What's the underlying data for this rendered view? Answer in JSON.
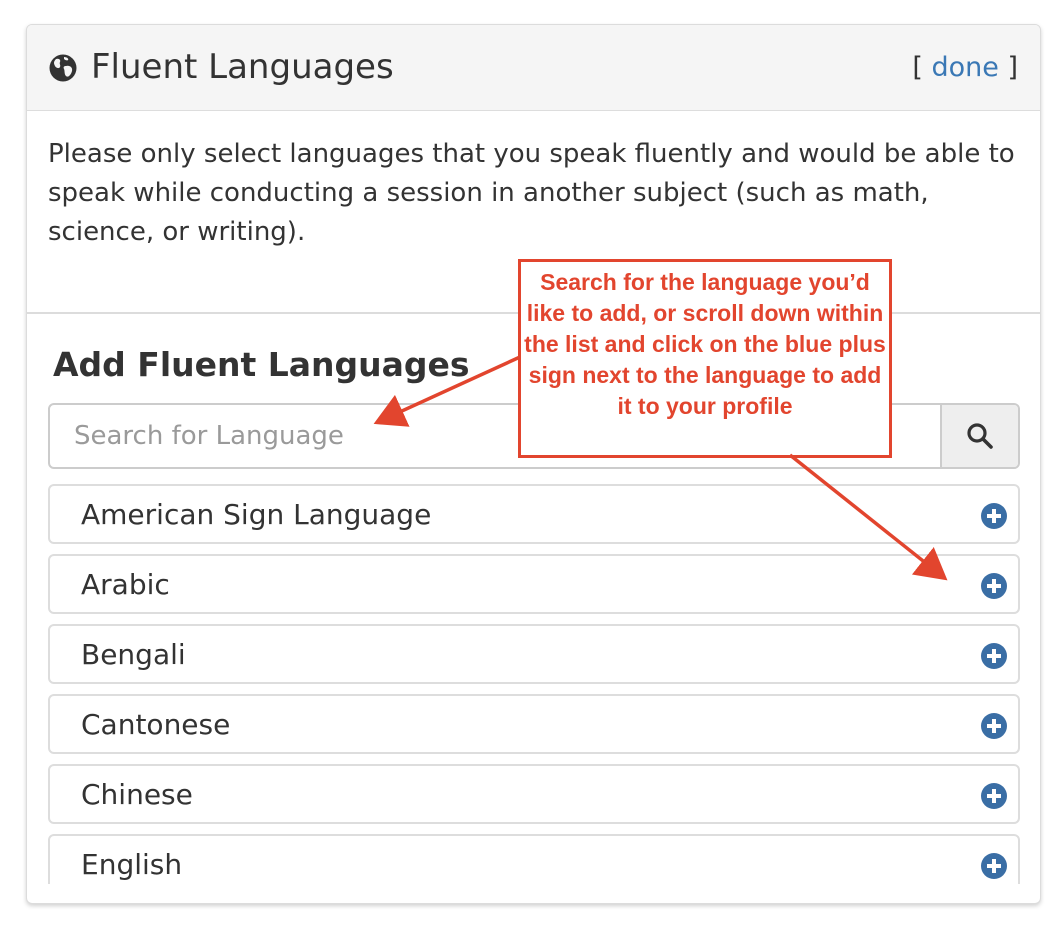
{
  "panel": {
    "title": "Fluent Languages",
    "icon": "globe-icon",
    "done_open_bracket": "[",
    "done_label": "done",
    "done_close_bracket": "]",
    "description": "Please only select languages that you speak fluently and would be able to speak while conducting a session in another subject (such as math, science, or writing)."
  },
  "add_section": {
    "title": "Add Fluent Languages",
    "search": {
      "placeholder": "Search for Language",
      "value": "",
      "button_icon": "search-icon"
    },
    "languages": [
      {
        "label": "American Sign Language",
        "action_icon": "plus-circle-icon"
      },
      {
        "label": "Arabic",
        "action_icon": "plus-circle-icon"
      },
      {
        "label": "Bengali",
        "action_icon": "plus-circle-icon"
      },
      {
        "label": "Cantonese",
        "action_icon": "plus-circle-icon"
      },
      {
        "label": "Chinese",
        "action_icon": "plus-circle-icon"
      },
      {
        "label": "English",
        "action_icon": "plus-circle-icon"
      }
    ]
  },
  "annotation": {
    "text": "Search for the language you’d like to add, or scroll down within the list and click on the blue plus sign next to the language to add it to your profile"
  },
  "colors": {
    "link": "#3a78b5",
    "add_icon": "#3a6ea5",
    "annotation": "#e2452e",
    "header_bg": "#f5f5f5",
    "text": "#333333"
  }
}
